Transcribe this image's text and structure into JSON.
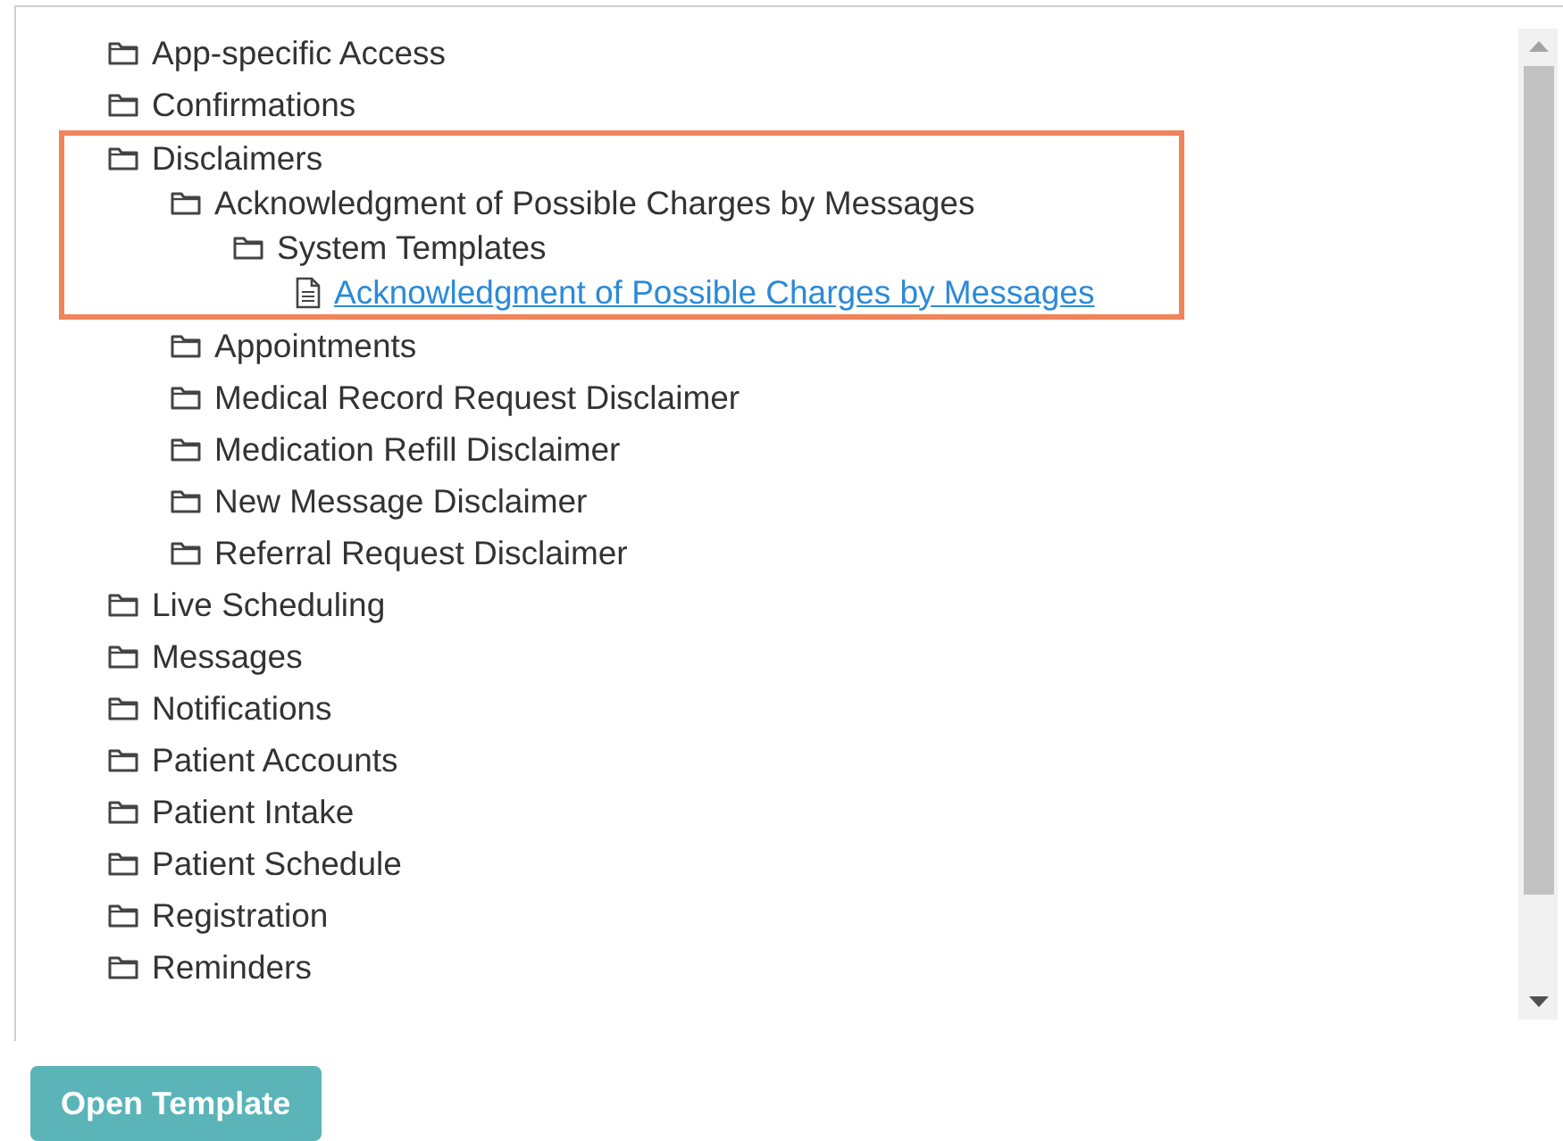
{
  "tree": {
    "items": [
      {
        "kind": "folder",
        "label": "App-specific Access",
        "highlighted": false
      },
      {
        "kind": "folder",
        "label": "Confirmations",
        "highlighted": false
      },
      {
        "kind": "folder",
        "label": "Disclaimers",
        "highlighted": true,
        "children": [
          {
            "kind": "folder",
            "label": "Acknowledgment of Possible Charges by Messages",
            "highlighted": true,
            "children": [
              {
                "kind": "folder",
                "label": "System Templates",
                "highlighted": true,
                "children": [
                  {
                    "kind": "file",
                    "label": "Acknowledgment of Possible Charges by Messages",
                    "highlighted": true
                  }
                ]
              }
            ]
          },
          {
            "kind": "folder",
            "label": "Appointments",
            "highlighted": false
          },
          {
            "kind": "folder",
            "label": "Medical Record Request Disclaimer",
            "highlighted": false
          },
          {
            "kind": "folder",
            "label": "Medication Refill Disclaimer",
            "highlighted": false
          },
          {
            "kind": "folder",
            "label": "New Message Disclaimer",
            "highlighted": false
          },
          {
            "kind": "folder",
            "label": "Referral Request Disclaimer",
            "highlighted": false
          }
        ]
      },
      {
        "kind": "folder",
        "label": "Live Scheduling",
        "highlighted": false
      },
      {
        "kind": "folder",
        "label": "Messages",
        "highlighted": false
      },
      {
        "kind": "folder",
        "label": "Notifications",
        "highlighted": false
      },
      {
        "kind": "folder",
        "label": "Patient Accounts",
        "highlighted": false
      },
      {
        "kind": "folder",
        "label": "Patient Intake",
        "highlighted": false
      },
      {
        "kind": "folder",
        "label": "Patient Schedule",
        "highlighted": false
      },
      {
        "kind": "folder",
        "label": "Registration",
        "highlighted": false
      },
      {
        "kind": "folder",
        "label": "Reminders",
        "highlighted": false
      }
    ]
  },
  "button": {
    "label": "Open Template"
  }
}
